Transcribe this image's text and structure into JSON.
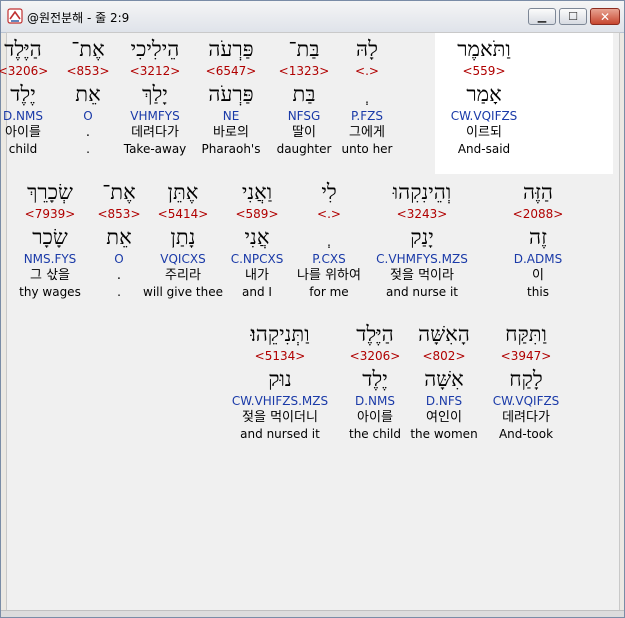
{
  "window": {
    "title": "@원전분해 - 줄 2:9"
  },
  "controls": {
    "minimize": "▁",
    "maximize": "☐",
    "close": "✕"
  },
  "icons": {
    "app": "app-icon"
  },
  "colors": {
    "strong": "#b00000",
    "parsing": "#1a3aa8",
    "highlight": "#ffffff"
  },
  "rows": [
    {
      "words": [
        {
          "heb": "וַתֹּאמֶר",
          "num": "<559>",
          "lemma": "אָמַר",
          "pars": "CW.VQIFZS",
          "kor": "이르되",
          "eng": "And-said",
          "highlight": true
        },
        {
          "heb": "לָהּ",
          "num": "<.>",
          "lemma": "ְ",
          "pars": "P.FZS",
          "kor": "그에게",
          "eng": "unto her"
        },
        {
          "heb": "בַּת־",
          "num": "<1323>",
          "lemma": "בַּת",
          "pars": "NFSG",
          "kor": "딸이",
          "eng": "daughter"
        },
        {
          "heb": "פַּרְעֹה",
          "num": "<6547>",
          "lemma": "פַּרְעֹה",
          "pars": "NE",
          "kor": "바로의",
          "eng": "Pharaoh's"
        },
        {
          "heb": "הֵילִיכִי",
          "num": "<3212>",
          "lemma": "יָלַךְ",
          "pars": "VHMFYS",
          "kor": "데려다가",
          "eng": "Take-away"
        },
        {
          "heb": "אֶת־",
          "num": "<853>",
          "lemma": "אֵת",
          "pars": "O",
          "kor": ".",
          "eng": "."
        },
        {
          "heb": "הַיֶּלֶד",
          "num": "<3206>",
          "lemma": "יֶלֶד",
          "pars": "D.NMS",
          "kor": "아이를",
          "eng": "child"
        }
      ]
    },
    {
      "words": [
        {
          "heb": "הַזֶּה",
          "num": "<2088>",
          "lemma": "זֶה",
          "pars": "D.ADMS",
          "kor": "이",
          "eng": "this"
        },
        {
          "heb": "וְהֵינִקִהוּ",
          "num": "<3243>",
          "lemma": "יָנַק",
          "pars": "C.VHMFYS.MZS",
          "kor": "젖을 먹이라",
          "eng": "and nurse it"
        },
        {
          "heb": "לִי",
          "num": "<.>",
          "lemma": "ְ",
          "pars": "P.CXS",
          "kor": "나를 위하여",
          "eng": "for me"
        },
        {
          "heb": "וַאֲנִי",
          "num": "<589>",
          "lemma": "אֲנִי",
          "pars": "C.NPCXS",
          "kor": "내가",
          "eng": "and I"
        },
        {
          "heb": "אֶתֵּן",
          "num": "<5414>",
          "lemma": "נָתַן",
          "pars": "VQICXS",
          "kor": "주리라",
          "eng": "will give thee"
        },
        {
          "heb": "אֶת־",
          "num": "<853>",
          "lemma": "אֵת",
          "pars": "O",
          "kor": ".",
          "eng": "."
        },
        {
          "heb": "שְׂכָרֵךְ",
          "num": "<7939>",
          "lemma": "שָׂכָר",
          "pars": "NMS.FYS",
          "kor": "그 삯을",
          "eng": "thy wages"
        }
      ]
    },
    {
      "words": [
        {
          "heb": "וַתִּקַּח",
          "num": "<3947>",
          "lemma": "לָקַח",
          "pars": "CW.VQIFZS",
          "kor": "데려다가",
          "eng": "And-took"
        },
        {
          "heb": "הָאִשָּׁה",
          "num": "<802>",
          "lemma": "אִשָּׁה",
          "pars": "D.NFS",
          "kor": "여인이",
          "eng": "the women"
        },
        {
          "heb": "הַיֶּלֶד",
          "num": "<3206>",
          "lemma": "יֶלֶד",
          "pars": "D.NMS",
          "kor": "아이를",
          "eng": "the child"
        },
        {
          "heb": "וַתְּנִיקֵהוּ׃",
          "num": "<5134>",
          "lemma": "נוּק",
          "pars": "CW.VHIFZS.MZS",
          "kor": "젖을 먹이더니",
          "eng": "and nursed it"
        }
      ]
    }
  ]
}
